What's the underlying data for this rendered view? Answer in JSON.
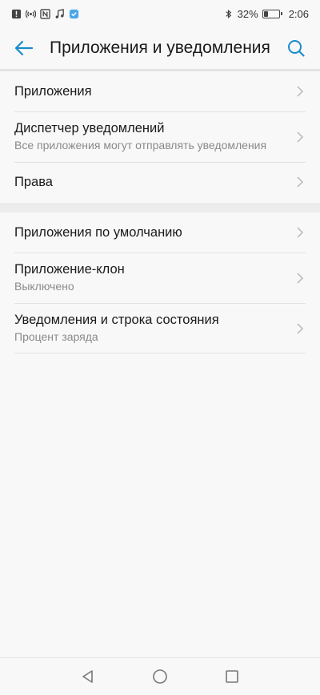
{
  "status_bar": {
    "battery_percent": "32%",
    "battery_level": 0.32,
    "time": "2:06",
    "left_icons": [
      "alert-icon",
      "hotspot-icon",
      "nfc-icon",
      "music-note-icon",
      "app-notification-icon"
    ],
    "right_icons": [
      "bluetooth-icon",
      "battery-icon"
    ]
  },
  "header": {
    "title": "Приложения и уведомления",
    "back_icon": "back-arrow-icon",
    "search_icon": "search-icon",
    "accent_color": "#1a8ccc"
  },
  "groups": [
    {
      "items": [
        {
          "title": "Приложения",
          "subtitle": ""
        },
        {
          "title": "Диспетчер уведомлений",
          "subtitle": "Все приложения могут отправлять уведомления"
        },
        {
          "title": "Права",
          "subtitle": ""
        }
      ]
    },
    {
      "items": [
        {
          "title": "Приложения по умолчанию",
          "subtitle": ""
        },
        {
          "title": "Приложение-клон",
          "subtitle": "Выключено"
        },
        {
          "title": "Уведомления и строка состояния",
          "subtitle": "Процент заряда"
        }
      ]
    }
  ],
  "nav_bar": {
    "icons": [
      "back-triangle-icon",
      "home-circle-icon",
      "recents-square-icon"
    ]
  }
}
